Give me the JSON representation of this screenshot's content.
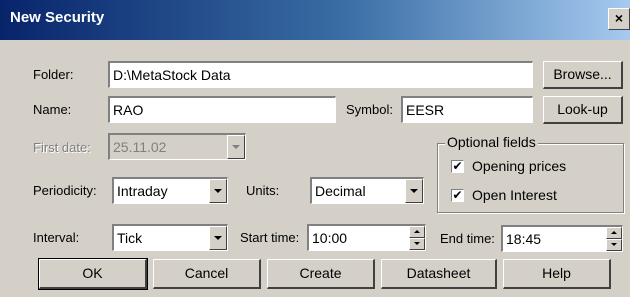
{
  "window": {
    "title": "New Security",
    "close_glyph": "×"
  },
  "form": {
    "folder": {
      "label": "Folder:",
      "value": "D:\\MetaStock Data",
      "browse_label": "Browse..."
    },
    "name": {
      "label": "Name:",
      "value": "RAO"
    },
    "symbol": {
      "label": "Symbol:",
      "value": "EESR",
      "lookup_label": "Look-up"
    },
    "first_date": {
      "label": "First date:",
      "value": "25.11.02"
    },
    "optional_fields": {
      "title": "Optional fields",
      "opening_prices": {
        "label": "Opening prices",
        "checked": true
      },
      "open_interest": {
        "label": "Open Interest",
        "checked": true
      }
    },
    "periodicity": {
      "label": "Periodicity:",
      "value": "Intraday"
    },
    "units": {
      "label": "Units:",
      "value": "Decimal"
    },
    "interval": {
      "label": "Interval:",
      "value": "Tick"
    },
    "start_time": {
      "label": "Start time:",
      "value": "10:00"
    },
    "end_time": {
      "label": "End time:",
      "value": "18:45"
    }
  },
  "buttons": {
    "ok": "OK",
    "cancel": "Cancel",
    "create": "Create",
    "datasheet": "Datasheet",
    "help": "Help"
  },
  "checkmark": "✔"
}
